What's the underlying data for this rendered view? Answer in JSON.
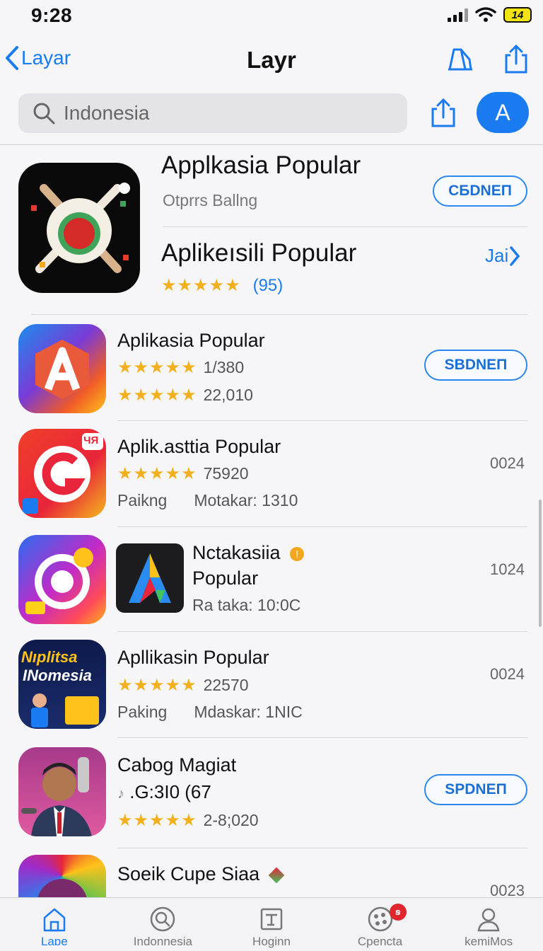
{
  "status": {
    "time": "9:28",
    "battery": "14"
  },
  "nav": {
    "back_label": "Layar",
    "title": "Layr"
  },
  "search": {
    "placeholder": "Indonesia",
    "avatar_letter": "A"
  },
  "featured": {
    "title": "Applkasia Popular",
    "subtitle": "Otprrs Ballng",
    "button_label": "CБDNEΠ",
    "title2": "Aplikeısili Popular",
    "rating_count": "(95)",
    "link_label": "Jai"
  },
  "apps": [
    {
      "title": "Aplikasia Popular",
      "line1": "1/380",
      "line2": "22,010",
      "button_label": "SBDNEΠ"
    },
    {
      "title": "Aplik.asttia Popular",
      "line1": "75920",
      "line2_a": "Paikng",
      "line2_b": "Motakar: 1310",
      "right_num": "0024",
      "badge": "ЧЯ"
    },
    {
      "title_line1": "Nctakasiia",
      "title_line2": "Popular",
      "line3": "Ra taka:  10:0C",
      "right_num": "1024"
    },
    {
      "title": "Apllikasin Popular",
      "line1": "22570",
      "line2_a": "Paking",
      "line2_b": "Mdaskar: 1NIC",
      "right_num": "0024",
      "icon_text1": "Nıplitsa",
      "icon_text2": "INomesia"
    },
    {
      "title": "Cabog Magiat",
      "line1": ".G:3I0 (67",
      "line2": "2-8;020",
      "button_label": "SPDNEΠ"
    },
    {
      "title": "Soeik Cupe Siaa",
      "right_num": "0023"
    }
  ],
  "tabs": [
    {
      "label": "Laɒe"
    },
    {
      "label": "Indonnesia"
    },
    {
      "label": "Hoginn"
    },
    {
      "label": "Cpencta",
      "badge": "ꞩ"
    },
    {
      "label": "kemiMos"
    }
  ],
  "colors": {
    "accent": "#1a7cf0",
    "star": "#f2b01e",
    "badge": "#e0262d"
  }
}
